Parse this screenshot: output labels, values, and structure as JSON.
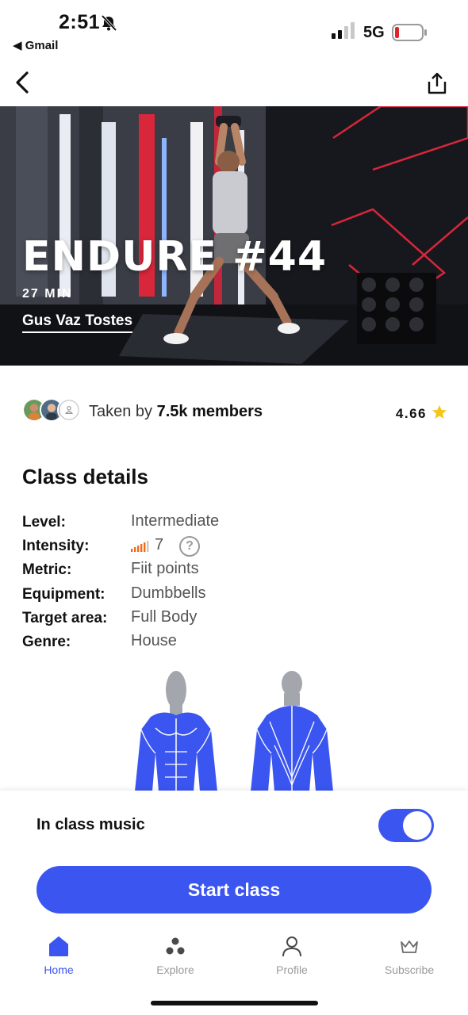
{
  "status_bar": {
    "time": "2:51",
    "back_app": "◀ Gmail",
    "network": "5G",
    "icons": [
      "bell-slash-icon",
      "signal-icon",
      "battery-icon"
    ]
  },
  "nav": {
    "back_icon": "chevron-left-icon",
    "share_icon": "share-icon"
  },
  "hero": {
    "title": "ENDURE #44",
    "duration": "27 MIN",
    "coach": "Gus Vaz Tostes"
  },
  "members": {
    "taken_prefix": "Taken by ",
    "taken_count": "7.5k members",
    "rating": "4.66",
    "star_color": "#f5c518"
  },
  "details": {
    "title": "Class details",
    "rows": [
      {
        "key": "Level:",
        "value": "Intermediate"
      },
      {
        "key": "Intensity:",
        "value": "7"
      },
      {
        "key": "Metric:",
        "value": "Fiit points"
      },
      {
        "key": "Equipment:",
        "value": "Dumbbells"
      },
      {
        "key": "Target area:",
        "value": "Full Body"
      },
      {
        "key": "Genre:",
        "value": "House"
      }
    ],
    "intensity_help": "?",
    "intensity_color": "#f26b1d"
  },
  "sheet": {
    "music_label": "In class music",
    "music_on": true,
    "start_label": "Start class"
  },
  "tabs": [
    {
      "label": "Home",
      "icon": "home-icon",
      "active": true
    },
    {
      "label": "Explore",
      "icon": "explore-icon",
      "active": false
    },
    {
      "label": "Profile",
      "icon": "profile-icon",
      "active": false
    },
    {
      "label": "Subscribe",
      "icon": "crown-icon",
      "active": false
    }
  ],
  "colors": {
    "accent": "#3b55f1",
    "muscle": "#3b55f1",
    "head": "#a3a6ad"
  }
}
